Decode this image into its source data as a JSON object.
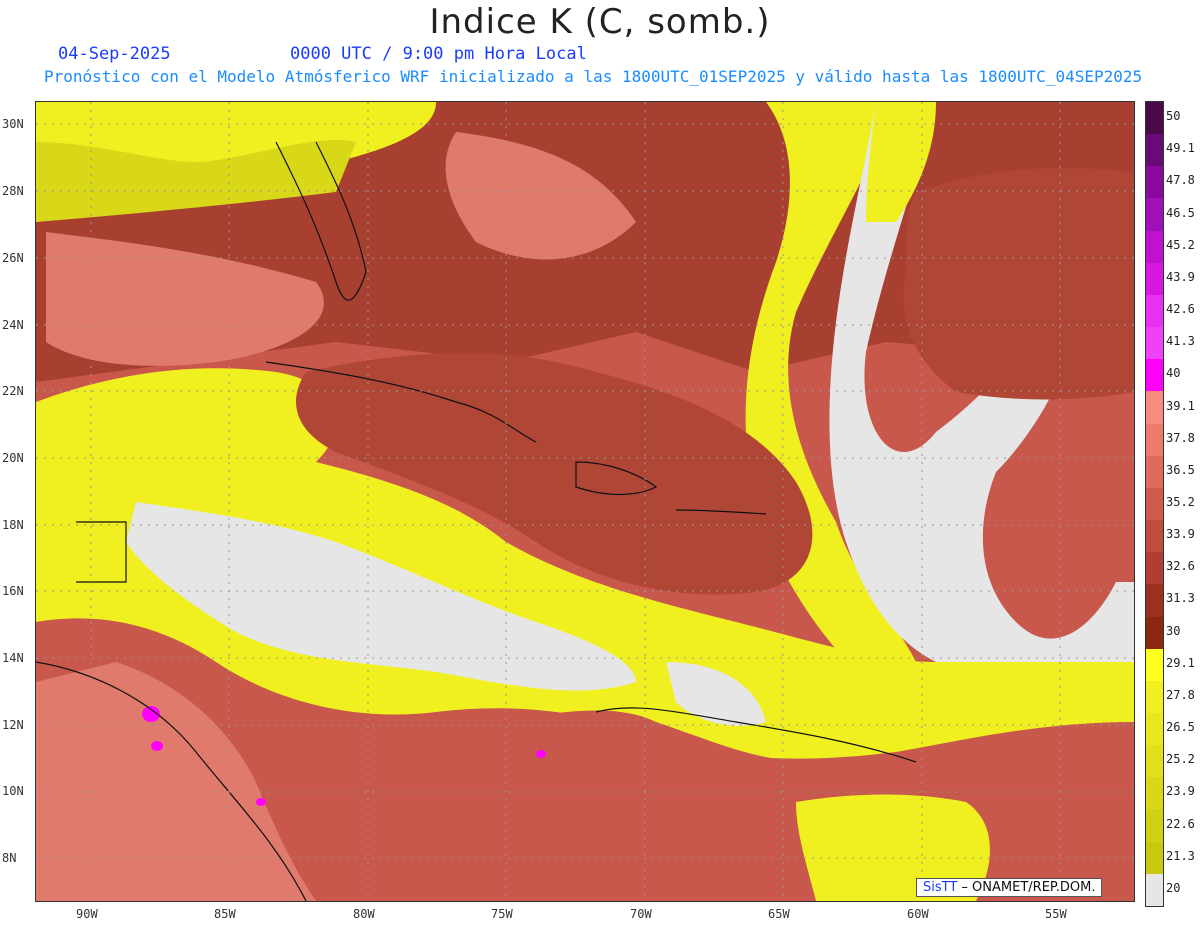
{
  "title": "Indice K (C, somb.)",
  "date": "04-Sep-2025",
  "time": "0000 UTC / 9:00 pm Hora Local",
  "subtitle": "Pronóstico con el Modelo Atmósferico WRF inicializado a las 1800UTC_01SEP2025 y válido hasta las  1800UTC_04SEP2025",
  "lat_labels": [
    "30N",
    "28N",
    "26N",
    "24N",
    "22N",
    "20N",
    "18N",
    "16N",
    "14N",
    "12N",
    "10N",
    "8N"
  ],
  "lon_labels": [
    "90W",
    "85W",
    "80W",
    "75W",
    "70W",
    "65W",
    "60W",
    "55W"
  ],
  "colorbar": {
    "labels": [
      "50",
      "49.1",
      "47.8",
      "46.5",
      "45.2",
      "43.9",
      "42.6",
      "41.3",
      "40",
      "39.1",
      "37.8",
      "36.5",
      "35.2",
      "33.9",
      "32.6",
      "31.3",
      "30",
      "29.1",
      "27.8",
      "26.5",
      "25.2",
      "23.9",
      "22.6",
      "21.3",
      "20"
    ],
    "colors": [
      "#4a0a4a",
      "#6a0a78",
      "#8a0aa0",
      "#a010b8",
      "#c010d0",
      "#d818e0",
      "#e830f0",
      "#f040f8",
      "#ff00ff",
      "#f88a7e",
      "#ee7a6e",
      "#e06a5e",
      "#d05a4e",
      "#c04c40",
      "#b03e32",
      "#9a3020",
      "#8a2810",
      "#ffff20",
      "#f0f020",
      "#e8e81e",
      "#e0e01c",
      "#d8d818",
      "#d0d014",
      "#c8c810",
      "#e6e6e6"
    ]
  },
  "credit": {
    "brand": "SisTT",
    "org": " – ONAMET/REP.DOM."
  }
}
